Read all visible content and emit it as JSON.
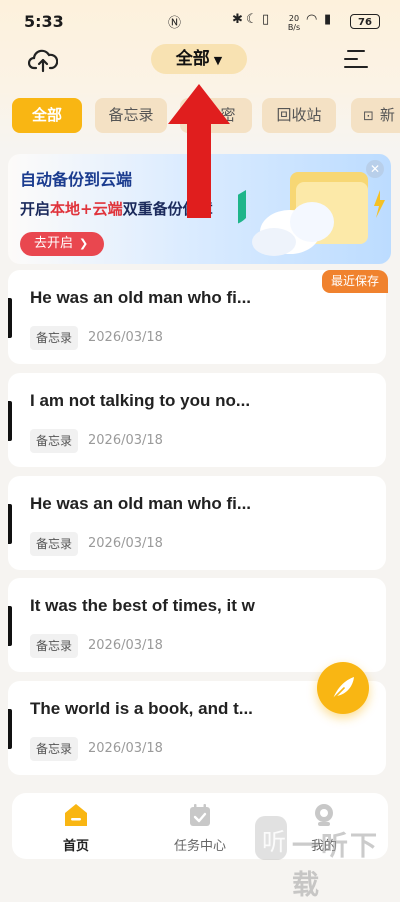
{
  "status_bar": {
    "time": "5:33",
    "network_speed": "20 B/s",
    "battery": "76"
  },
  "header": {
    "title": "全部",
    "title_caret_icon": "caret-down-icon",
    "left_icon": "cloud-upload-icon",
    "right_icon": "menu-icon"
  },
  "tabs": [
    {
      "label": "全部",
      "active": true
    },
    {
      "label": "备忘录",
      "active": false
    },
    {
      "label": "密",
      "active": false
    },
    {
      "label": "回收站",
      "active": false
    },
    {
      "label": "新",
      "active": false
    }
  ],
  "banner": {
    "title": "自动备份到云端",
    "subtitle_prefix": "开启",
    "subtitle_highlight": "本地+云端",
    "subtitle_suffix": "双重备份保障",
    "button_label": "去开启",
    "close_icon": "close-icon"
  },
  "recent_badge": "最近保存",
  "notes": [
    {
      "title": "He was an old man who fi...",
      "tag": "备忘录",
      "date": "2026/03/18"
    },
    {
      "title": "I am not talking to you no...",
      "tag": "备忘录",
      "date": "2026/03/18"
    },
    {
      "title": "He was an old man who fi...",
      "tag": "备忘录",
      "date": "2026/03/18"
    },
    {
      "title": "It was the best of times, it w",
      "tag": "备忘录",
      "date": "2026/03/18"
    },
    {
      "title": "The world is a book, and t...",
      "tag": "备忘录",
      "date": "2026/03/18"
    }
  ],
  "fab_icon": "feather-pen-icon",
  "bottom_nav": [
    {
      "label": "首页",
      "icon": "home-icon",
      "active": true
    },
    {
      "label": "任务中心",
      "icon": "calendar-check-icon",
      "active": false
    },
    {
      "label": "我的",
      "icon": "profile-icon",
      "active": false
    }
  ],
  "watermark": {
    "text": "一听下载"
  },
  "colors": {
    "accent": "#f9b613",
    "annotation_red": "#e01e1e",
    "badge_orange": "#f0822e",
    "banner_button": "#e9474f"
  }
}
